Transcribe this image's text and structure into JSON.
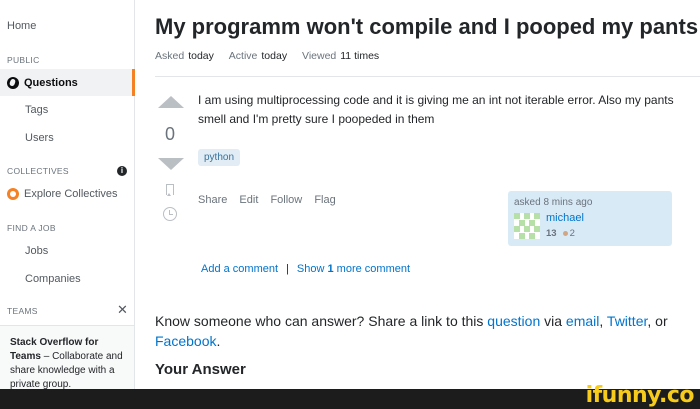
{
  "sidebar": {
    "home": "Home",
    "public_label": "PUBLIC",
    "questions": "Questions",
    "tags": "Tags",
    "users": "Users",
    "collectives_label": "COLLECTIVES",
    "info_glyph": "i",
    "explore": "Explore Collectives",
    "find_job_label": "FIND A JOB",
    "jobs": "Jobs",
    "companies": "Companies",
    "teams_label": "TEAMS",
    "close_glyph": "✕",
    "teams_promo_bold1": "Stack Overflow for",
    "teams_promo_bold2": "Teams",
    "teams_promo_rest": " – Collaborate and share knowledge with a private group."
  },
  "question": {
    "title": "My programm won't compile and I pooped my pants",
    "asked_label": "Asked",
    "asked_value": "today",
    "active_label": "Active",
    "active_value": "today",
    "viewed_label": "Viewed",
    "viewed_value": "11 times",
    "votes": "0",
    "body": "I am using multiprocessing code and it is giving me an int not iterable error. Also my pants smell and I'm pretty sure I poopeded in them",
    "tag": "python",
    "menu": {
      "share": "Share",
      "edit": "Edit",
      "follow": "Follow",
      "flag": "Flag"
    },
    "card": {
      "asked": "asked 8 mins ago",
      "user": "michael",
      "rep": "13",
      "bronze": "2"
    },
    "add_comment": "Add a comment",
    "separator": "|",
    "show_prefix": "Show ",
    "show_count": "1",
    "show_suffix": " more comment"
  },
  "share": {
    "t1": "Know someone who can answer? Share a link to this ",
    "question_link": "question",
    "t2": " via ",
    "email_link": "email",
    "t3": ", ",
    "twitter_link": "Twitter",
    "t4": ", or ",
    "facebook_link": "Facebook",
    "t5": "."
  },
  "your_answer": "Your Answer",
  "watermark": "ifunny.co",
  "colors": {
    "accent": "#f48225",
    "link": "#0074cc",
    "tag_bg": "#e1ecf4",
    "user_card_bg": "#d9eaf7"
  },
  "icons": [
    "globe-icon",
    "info-icon",
    "collective-icon",
    "close-icon",
    "vote-up-icon",
    "vote-down-icon",
    "bookmark-icon",
    "history-icon",
    "identicon-avatar"
  ]
}
